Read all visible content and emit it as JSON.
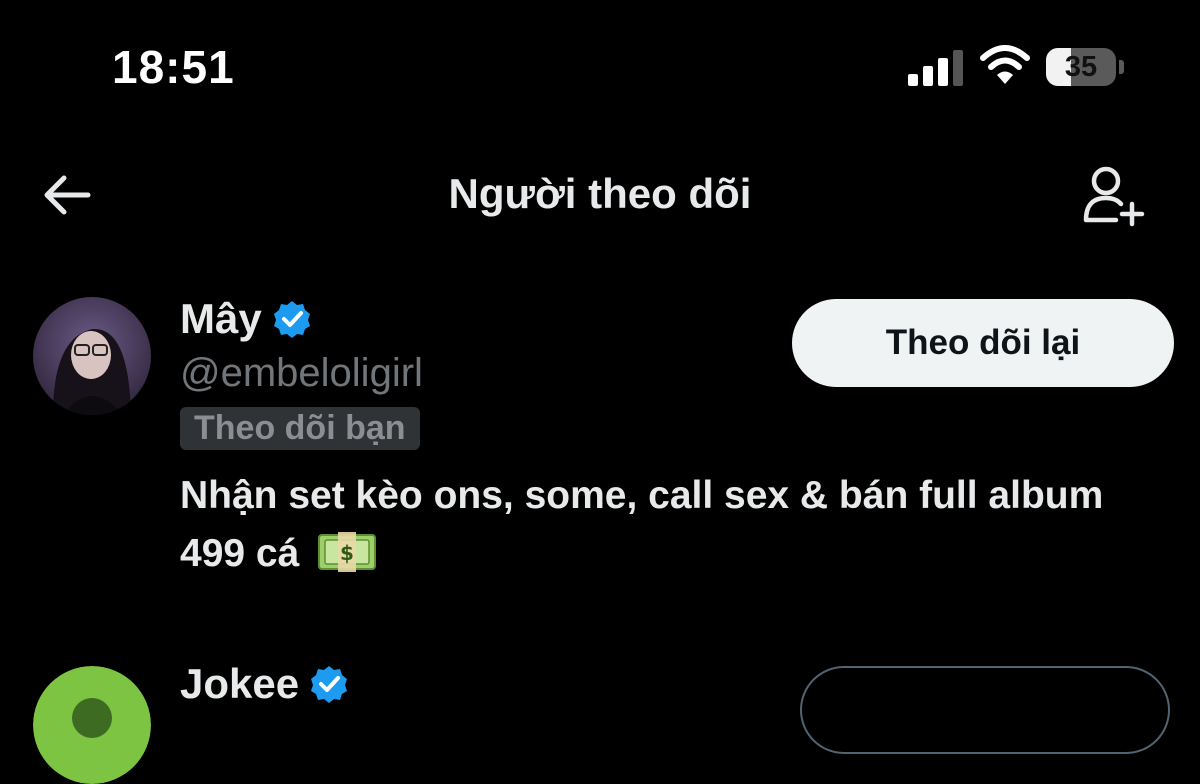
{
  "status_bar": {
    "time": "18:51",
    "battery_level": "35",
    "battery_fraction": 0.35
  },
  "header": {
    "title": "Người theo dõi",
    "back_icon": "arrow-left-icon",
    "action_icon": "add-user-icon"
  },
  "followers": [
    {
      "name": "Mây",
      "verified": true,
      "handle": "@embeloligirl",
      "follows_you_label": "Theo dõi bạn",
      "bio": "Nhận set kèo ons, some, call sex & bán full album 499 cá",
      "bio_emoji": "money-bag-icon",
      "button_label": "Theo dõi lại"
    },
    {
      "name": "Jokee",
      "verified": true
    }
  ],
  "colors": {
    "background": "#000000",
    "verified_blue": "#1d9bf0",
    "primary_text": "#e7e9ea",
    "secondary_text": "#71767b",
    "button_bg": "#eff3f4"
  }
}
